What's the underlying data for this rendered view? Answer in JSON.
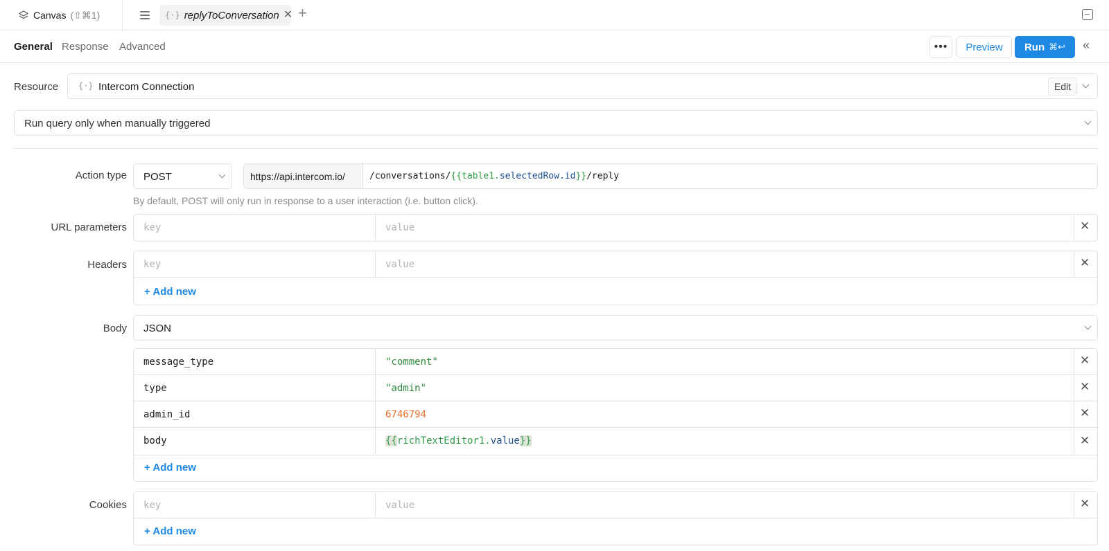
{
  "topbar": {
    "canvas_label": "Canvas",
    "canvas_hint": "(⇧⌘1)",
    "tab_label": "replyToConversation",
    "tab_icon": "brace-icon",
    "close_glyph": "✕",
    "plus_glyph": "+"
  },
  "subtabs": {
    "general": "General",
    "response": "Response",
    "advanced": "Advanced"
  },
  "toolbar": {
    "more_glyph": "•••",
    "preview_label": "Preview",
    "run_label": "Run",
    "run_kbd": "⌘↩",
    "collapse_glyph": "«"
  },
  "resource": {
    "label": "Resource",
    "value": "Intercom Connection",
    "edit_label": "Edit"
  },
  "trigger": {
    "value": "Run query only when manually triggered"
  },
  "action": {
    "label": "Action type",
    "method": "POST",
    "base_url": "https://api.intercom.io/",
    "path_prefix": "/conversations/",
    "tmpl_open": "{{",
    "tmpl_obj": "table1.",
    "tmpl_prop": "selectedRow.id",
    "tmpl_close": "}}",
    "path_suffix": "/reply",
    "help": "By default, POST will only run in response to a user interaction (i.e. button click)."
  },
  "url_params": {
    "label": "URL parameters",
    "key_placeholder": "key",
    "value_placeholder": "value"
  },
  "headers": {
    "label": "Headers",
    "key_placeholder": "key",
    "value_placeholder": "value",
    "add_new": "+ Add new"
  },
  "body": {
    "label": "Body",
    "format": "JSON",
    "rows": [
      {
        "key": "message_type",
        "value": "\"comment\""
      },
      {
        "key": "type",
        "value": "\"admin\""
      },
      {
        "key": "admin_id",
        "value": "6746794"
      }
    ],
    "template_row": {
      "key": "body",
      "open": "{{",
      "obj": "richTextEditor1.",
      "prop": "value",
      "close": "}}"
    },
    "add_new": "+ Add new"
  },
  "cookies": {
    "label": "Cookies",
    "key_placeholder": "key",
    "value_placeholder": "value",
    "add_new": "+ Add new"
  },
  "colors": {
    "accent": "#1e88e5",
    "string": "#2e8b3e",
    "number": "#e8702a"
  }
}
